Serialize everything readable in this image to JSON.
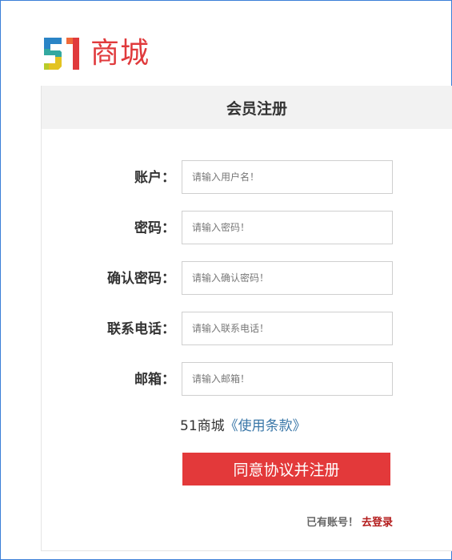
{
  "brand": {
    "logo_text": "商城",
    "logo_mark": "51-logo"
  },
  "panel": {
    "title": "会员注册"
  },
  "form": {
    "fields": [
      {
        "label": "账户：",
        "placeholder": "请输入用户名！"
      },
      {
        "label": "密码：",
        "placeholder": "请输入密码！"
      },
      {
        "label": "确认密码：",
        "placeholder": "请输入确认密码！"
      },
      {
        "label": "联系电话：",
        "placeholder": "请输入联系电话！"
      },
      {
        "label": "邮箱：",
        "placeholder": "请输入邮箱！"
      }
    ],
    "terms_prefix": "51商城",
    "terms_link": "《使用条款》",
    "submit_label": "同意协议并注册",
    "login_prompt": "已有账号！",
    "login_link": "去登录"
  },
  "colors": {
    "brand_red": "#e03a3c",
    "button_red": "#e3393a",
    "link_blue": "#3a77a8",
    "login_link_red": "#b31b1b",
    "header_bg": "#f2f2f2"
  }
}
